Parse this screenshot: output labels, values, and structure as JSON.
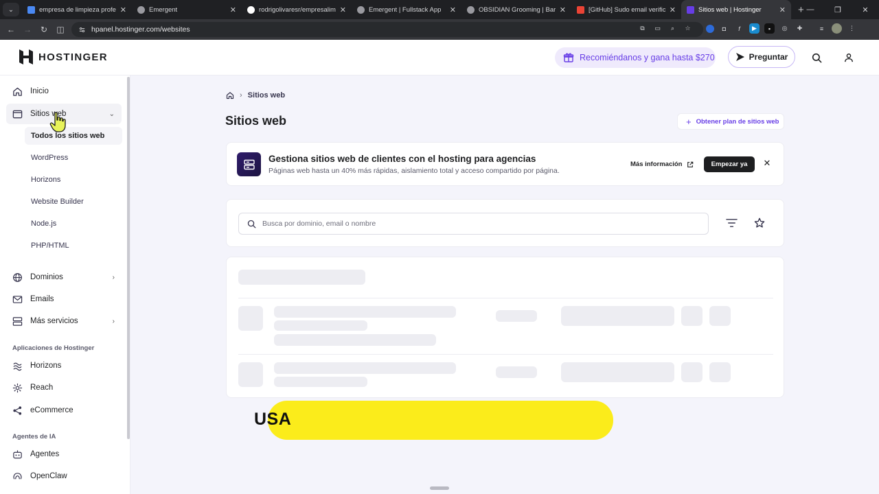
{
  "browser": {
    "tabs": [
      {
        "title": "empresa de limpieza profesional",
        "favicon_color": "#4a89f3"
      },
      {
        "title": "Emergent",
        "favicon_color": "#9a9aa0"
      },
      {
        "title": "rodrigolivaresr/empresalimpieza",
        "favicon_color": "#ffffff"
      },
      {
        "title": "Emergent | Fullstack App",
        "favicon_color": "#9a9aa0"
      },
      {
        "title": "OBSIDIAN Grooming | Barbería",
        "favicon_color": "#9a9aa0"
      },
      {
        "title": "[GitHub] Sudo email verification",
        "favicon_color": "#ea4335"
      },
      {
        "title": "Sitios web | Hostinger",
        "favicon_color": "#673de6"
      }
    ],
    "url": "hpanel.hostinger.com/websites"
  },
  "header": {
    "logo_text": "HOSTINGER",
    "promo": "Recomiéndanos y gana hasta $270",
    "ask_label": "Preguntar"
  },
  "sidebar": {
    "items": [
      {
        "label": "Inicio"
      },
      {
        "label": "Sitios web"
      },
      {
        "label": "Dominios"
      },
      {
        "label": "Emails"
      },
      {
        "label": "Más servicios"
      }
    ],
    "sub_items": [
      "Todos los sitios web",
      "WordPress",
      "Horizons",
      "Website Builder",
      "Node.js",
      "PHP/HTML"
    ],
    "sections": [
      {
        "title": "Aplicaciones de Hostinger",
        "items": [
          "Horizons",
          "Reach",
          "eCommerce"
        ]
      },
      {
        "title": "Agentes de IA",
        "items": [
          "Agentes",
          "OpenClaw"
        ]
      }
    ]
  },
  "main": {
    "breadcrumb": "Sitios web",
    "title": "Sitios web",
    "get_plan": "Obtener plan de sitios web",
    "agency": {
      "title": "Gestiona sitios web de clientes con el hosting para agencias",
      "subtitle": "Páginas web hasta un 40% más rápidas, aislamiento total y acceso compartido por página.",
      "more": "Más información",
      "start": "Empezar ya"
    },
    "search_placeholder": "Busca por dominio, email o nombre"
  },
  "overlay": {
    "banner_text": "USA",
    "banner_color": "#fbec1b"
  },
  "colors": {
    "accent": "#673de6",
    "dark": "#1d1e20"
  }
}
